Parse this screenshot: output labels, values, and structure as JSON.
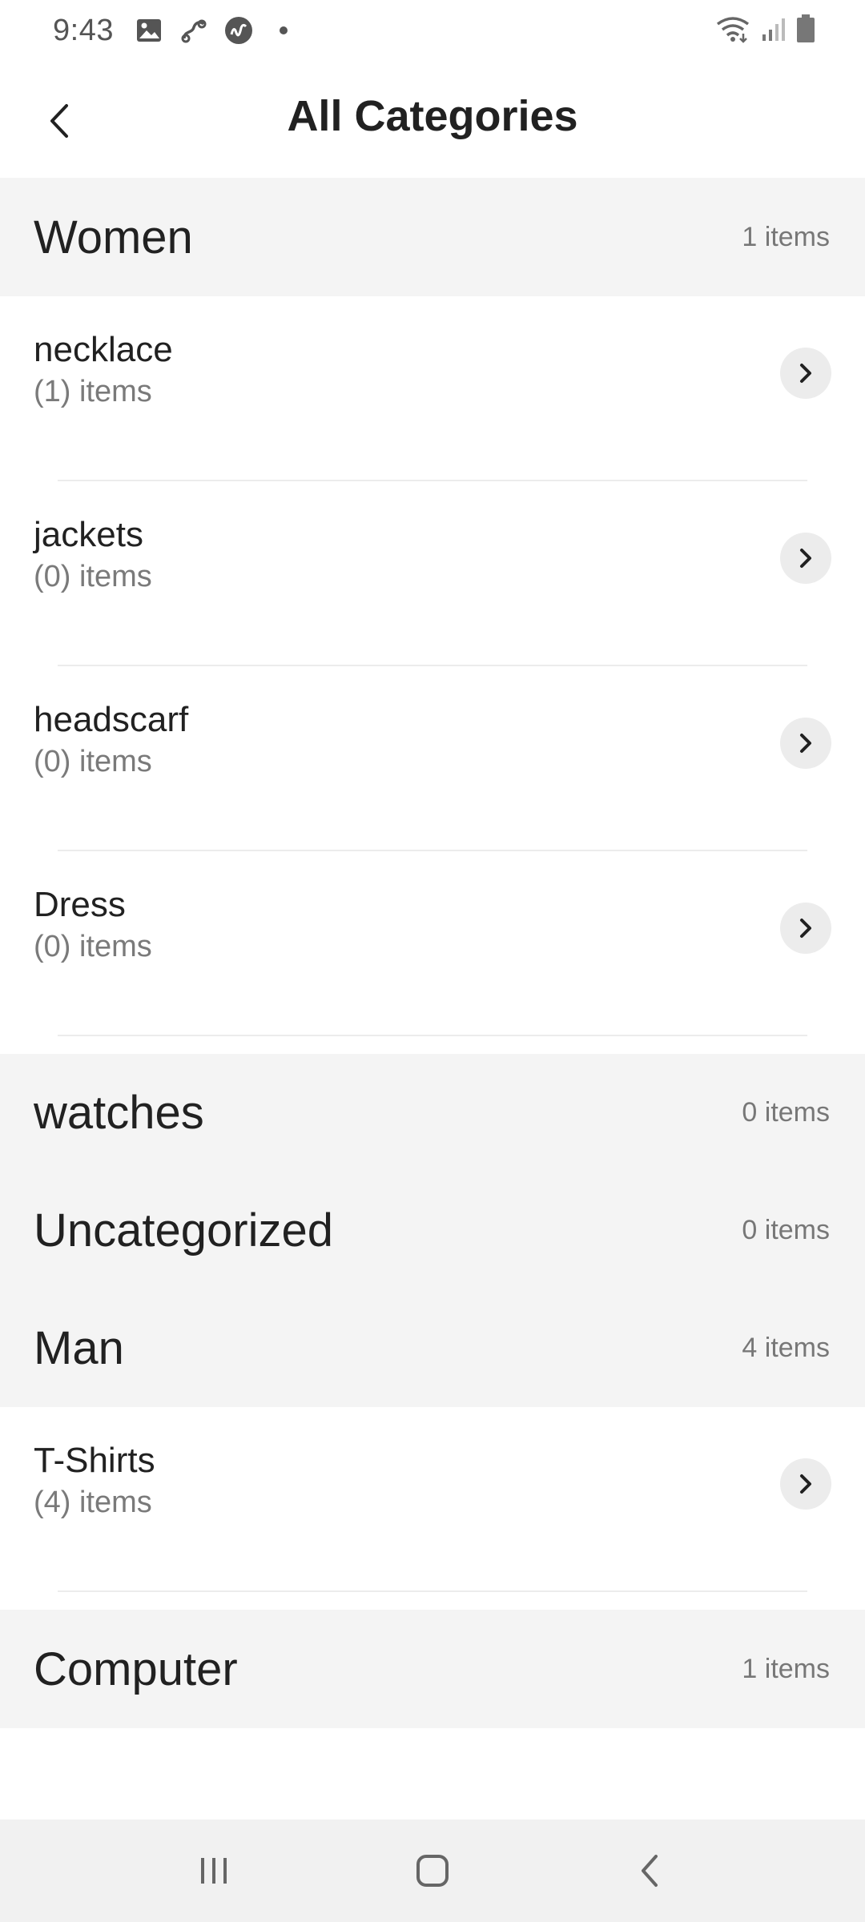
{
  "status_bar": {
    "time": "9:43",
    "left_icons": [
      "gallery-icon",
      "link-icon",
      "app-icon",
      "dot-icon"
    ],
    "right_icons": [
      "wifi-icon",
      "signal-icon",
      "battery-icon"
    ]
  },
  "header": {
    "title": "All Categories",
    "back_icon": "back-chevron-icon"
  },
  "categories": [
    {
      "name": "Women",
      "count": "1 items",
      "subcategories": [
        {
          "name": "necklace",
          "count": "(1) items"
        },
        {
          "name": "jackets",
          "count": "(0) items"
        },
        {
          "name": "headscarf",
          "count": "(0) items"
        },
        {
          "name": "Dress",
          "count": "(0) items"
        }
      ]
    },
    {
      "name": "watches",
      "count": "0 items",
      "subcategories": []
    },
    {
      "name": "Uncategorized",
      "count": "0 items",
      "subcategories": []
    },
    {
      "name": "Man",
      "count": "4 items",
      "subcategories": [
        {
          "name": "T-Shirts",
          "count": "(4) items"
        }
      ]
    },
    {
      "name": "Computer",
      "count": "1 items",
      "subcategories": []
    }
  ],
  "nav_bar": {
    "icons": [
      "recents-icon",
      "home-icon",
      "back-icon"
    ]
  },
  "colors": {
    "section_bg": "#f4f4f4",
    "chevron_bg": "#ececec",
    "text_primary": "#212121",
    "text_secondary": "#777777"
  }
}
